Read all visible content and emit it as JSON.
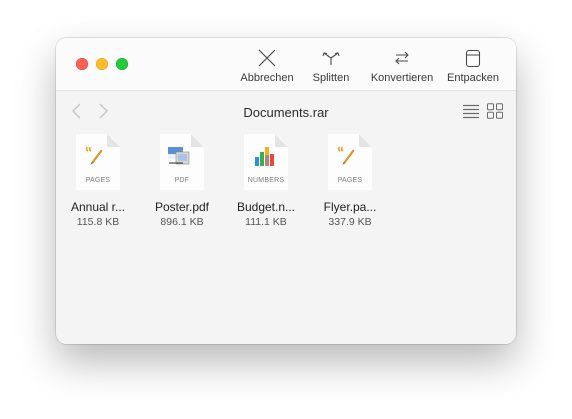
{
  "toolbar": {
    "buttons": [
      {
        "label": "Abbrechen",
        "icon": "x-icon"
      },
      {
        "label": "Splitten",
        "icon": "split-arrows-icon"
      },
      {
        "label": "Konvertieren",
        "icon": "convert-arrows-icon"
      },
      {
        "label": "Entpacken",
        "icon": "unpack-box-icon"
      }
    ]
  },
  "header": {
    "title": "Documents.rar"
  },
  "files": [
    {
      "name": "Annual r...",
      "size": "115.8 KB",
      "kind": "PAGES",
      "icon": "pages-document-icon"
    },
    {
      "name": "Poster.pdf",
      "size": "896.1 KB",
      "kind": "PDF",
      "icon": "pdf-document-icon"
    },
    {
      "name": "Budget.n...",
      "size": "111.1 KB",
      "kind": "NUMBERS",
      "icon": "numbers-document-icon"
    },
    {
      "name": "Flyer.pa...",
      "size": "337.9 KB",
      "kind": "PAGES",
      "icon": "pages-document-icon"
    }
  ],
  "colors": {
    "close": "#fe5f57",
    "minimize": "#febc2e",
    "zoom": "#28c840",
    "window_bg": "#f4f4f4"
  }
}
